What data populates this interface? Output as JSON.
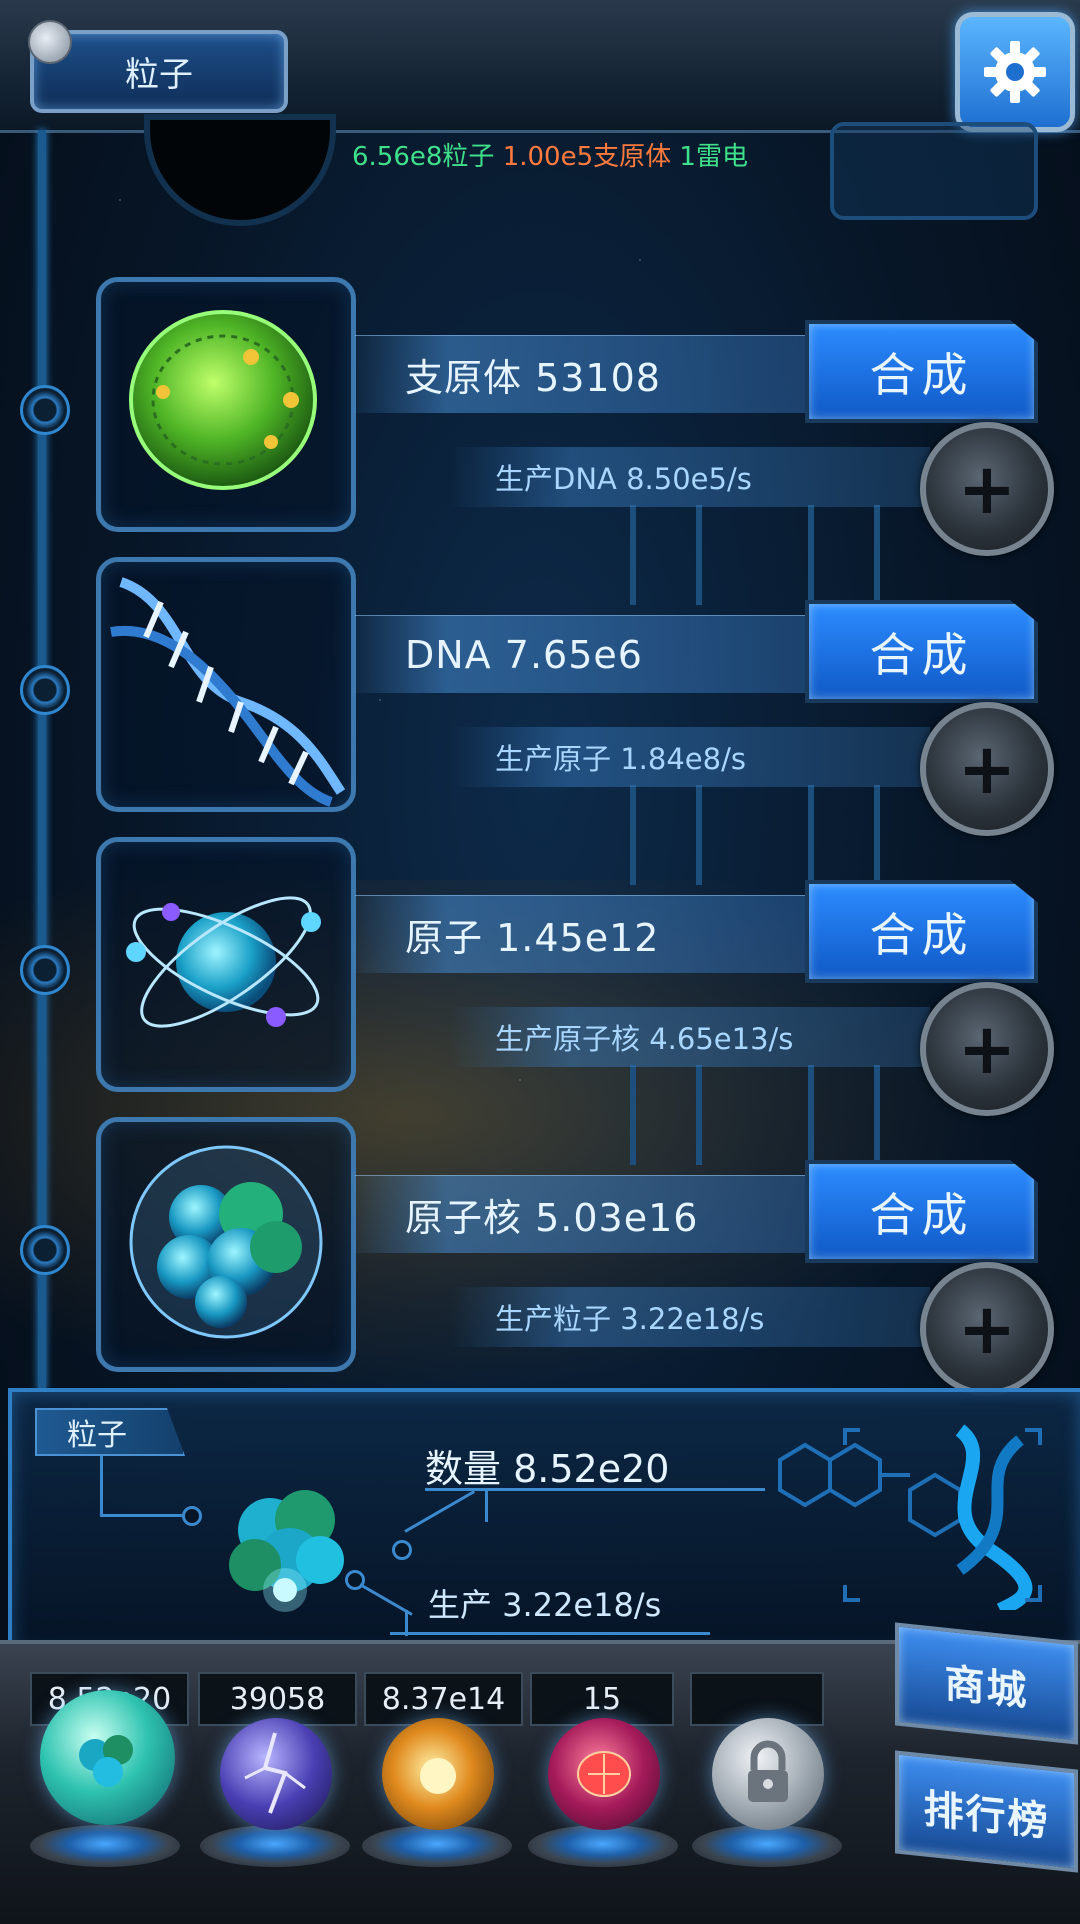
{
  "header": {
    "title": "粒子",
    "status": {
      "particles": "6.56e8粒子",
      "mycoplasma": "1.00e5支原体",
      "thunder": "1雷电"
    }
  },
  "rows": [
    {
      "name": "支原体 53108",
      "production": "生产DNA 8.50e5/s",
      "action": "合成",
      "icon": "cell-icon"
    },
    {
      "name": "DNA 7.65e6",
      "production": "生产原子 1.84e8/s",
      "action": "合成",
      "icon": "dna-icon"
    },
    {
      "name": "原子 1.45e12",
      "production": "生产原子核 4.65e13/s",
      "action": "合成",
      "icon": "atom-icon"
    },
    {
      "name": "原子核 5.03e16",
      "production": "生产粒子 3.22e18/s",
      "action": "合成",
      "icon": "nucleus-icon"
    }
  ],
  "info": {
    "tag": "粒子",
    "quantity": "数量 8.52e20",
    "production": "生产 3.22e18/s"
  },
  "dock": {
    "counters": [
      "8.52e20",
      "39058",
      "8.37e14",
      "15",
      ""
    ],
    "orbs": [
      "particle-orb-icon",
      "lightning-orb-icon",
      "explosion-orb-icon",
      "brain-orb-icon",
      "lock-orb-icon"
    ],
    "shop_label": "商城",
    "rank_label": "排行榜"
  },
  "colors": {
    "accent_blue": "#2c8cff",
    "status_green": "#3fe08a",
    "status_orange": "#ff7a3c"
  }
}
